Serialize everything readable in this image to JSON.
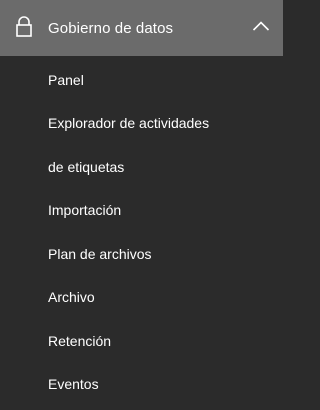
{
  "section": {
    "title": "Gobierno de datos",
    "icon": "lock-icon",
    "toggle_icon": "chevron-up-icon",
    "expanded": true,
    "colors": {
      "header_background": "#6b6b6b",
      "menu_background": "#2b2b2b",
      "text": "#ffffff"
    }
  },
  "items": [
    {
      "label": "Panel"
    },
    {
      "label": "Explorador de actividades"
    },
    {
      "label": "de etiquetas"
    },
    {
      "label": "Importación"
    },
    {
      "label": "Plan de archivos"
    },
    {
      "label": "Archivo"
    },
    {
      "label": "Retención"
    },
    {
      "label": "Eventos"
    }
  ]
}
